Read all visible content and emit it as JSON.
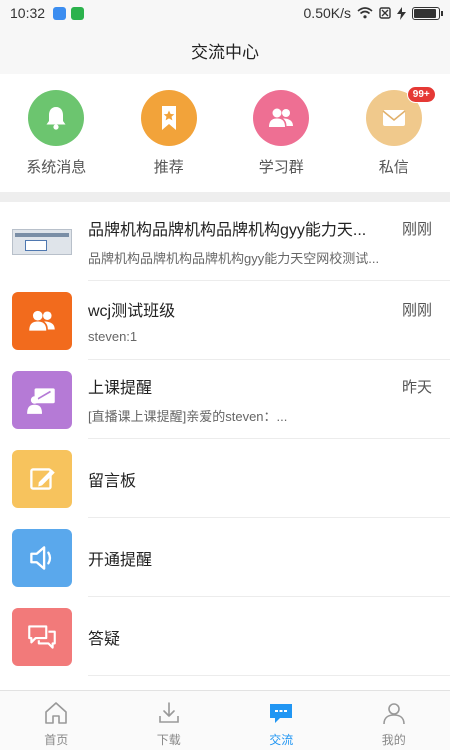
{
  "status_bar": {
    "time": "10:32",
    "speed": "0.50K/s"
  },
  "header": {
    "title": "交流中心"
  },
  "quick_entries": [
    {
      "label": "系统消息",
      "icon": "bell-icon",
      "color": "#6cc56f"
    },
    {
      "label": "推荐",
      "icon": "bookmark-star-icon",
      "color": "#f2a33a"
    },
    {
      "label": "学习群",
      "icon": "group-icon",
      "color": "#ee6f93"
    },
    {
      "label": "私信",
      "icon": "mail-icon",
      "color": "#f0c98c",
      "badge": "99+"
    }
  ],
  "messages": [
    {
      "title": "品牌机构品牌机构品牌机构gyy能力天...",
      "time": "刚刚",
      "subtitle": "品牌机构品牌机构品牌机构gyy能力天空网校测试...",
      "icon": "screenshot-thumbnail"
    },
    {
      "title": "wcj测试班级",
      "time": "刚刚",
      "subtitle": "steven:1",
      "icon": "group-icon",
      "color": "#f26b1d"
    },
    {
      "title": "上课提醒",
      "time": "昨天",
      "subtitle": "[直播课上课提醒]亲爱的steven：...",
      "icon": "teacher-board-icon",
      "color": "#b57ad6"
    },
    {
      "title": "留言板",
      "icon": "edit-note-icon",
      "color": "#f7c35d"
    },
    {
      "title": "开通提醒",
      "icon": "speaker-icon",
      "color": "#5aa8ec"
    },
    {
      "title": "答疑",
      "icon": "chat-bubbles-icon",
      "color": "#f27a7a"
    }
  ],
  "bottom_nav": [
    {
      "label": "首页",
      "icon": "home-icon"
    },
    {
      "label": "下载",
      "icon": "download-icon"
    },
    {
      "label": "交流",
      "icon": "chat-icon",
      "active": true
    },
    {
      "label": "我的",
      "icon": "profile-icon"
    }
  ],
  "colors": {
    "accent": "#2196f3",
    "badge": "#e53935"
  }
}
